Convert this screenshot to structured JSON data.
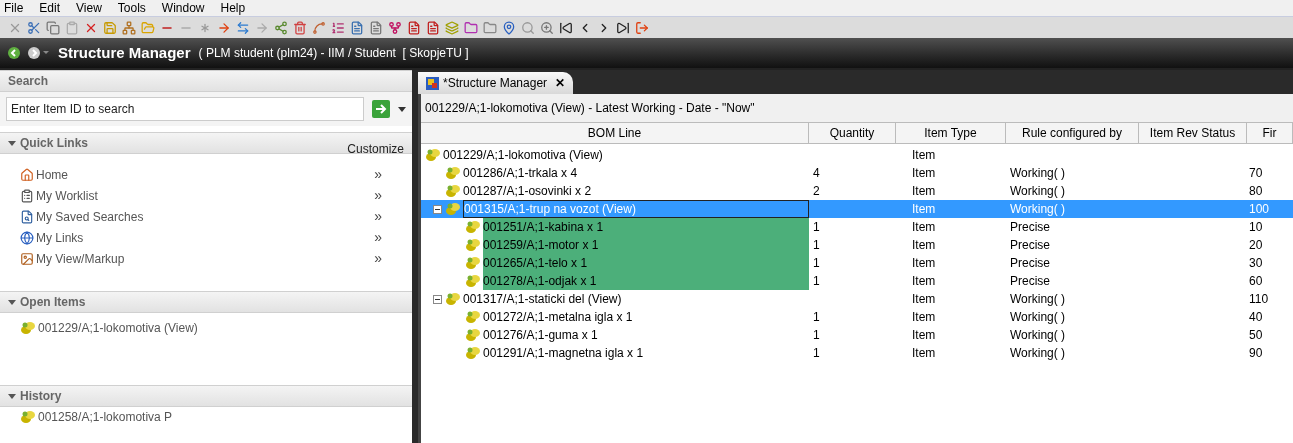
{
  "menu": [
    "File",
    "Edit",
    "View",
    "Tools",
    "Window",
    "Help"
  ],
  "header": {
    "title": "Structure Manager",
    "context": "( PLM student (plm24) - IIM / Student  [ SkopjeTU ]"
  },
  "sidebar": {
    "search": {
      "title": "Search",
      "placeholder": "Enter Item ID to search"
    },
    "quick_links": {
      "title": "Quick Links",
      "expanded": true,
      "action": "Customize",
      "items": [
        {
          "label": "Home",
          "kind": "home",
          "more": "»"
        },
        {
          "label": "My Worklist",
          "kind": "worklist",
          "more": "»"
        },
        {
          "label": "My Saved Searches",
          "kind": "searches",
          "more": "»"
        },
        {
          "label": "My Links",
          "kind": "links",
          "more": "»"
        },
        {
          "label": "My View/Markup",
          "kind": "markup",
          "more": "»"
        }
      ]
    },
    "open_items": {
      "title": "Open Items",
      "expanded": true,
      "items": [
        "001229/A;1-lokomotiva (View)"
      ]
    },
    "history": {
      "title": "History",
      "expanded": true,
      "items": [
        "001258/A;1-lokomotiva P"
      ]
    }
  },
  "editor": {
    "tab": {
      "label": "*Structure Manager",
      "close": "✕"
    },
    "path": "001229/A;1-lokomotiva (View) - Latest Working - Date - \"Now\"",
    "table": {
      "columns": [
        "BOM Line",
        "Quantity",
        "Item Type",
        "Rule configured by",
        "Item Rev Status",
        "Fir"
      ],
      "rows": [
        {
          "bom_line": "001229/A;1-lokomotiva (View)",
          "item_type": "Item",
          "selected": false,
          "highlighted": false,
          "children": [
            {
              "bom_line": "001286/A;1-trkala x 4",
              "quantity": "4",
              "item_type": "Item",
              "rule": "Working( )",
              "find_no": "70",
              "selected": false,
              "highlighted": false
            },
            {
              "bom_line": "001287/A;1-osovinki x 2",
              "quantity": "2",
              "item_type": "Item",
              "rule": "Working( )",
              "find_no": "80",
              "selected": false,
              "highlighted": false
            },
            {
              "bom_line": "001315/A;1-trup na vozot (View)",
              "item_type": "Item",
              "rule": "Working( )",
              "find_no": "100",
              "selected": true,
              "highlighted": false,
              "expanded": true,
              "children": [
                {
                  "bom_line": "001251/A;1-kabina x 1",
                  "quantity": "1",
                  "item_type": "Item",
                  "rule": "Precise",
                  "find_no": "10",
                  "selected": false,
                  "highlighted": true
                },
                {
                  "bom_line": "001259/A;1-motor x 1",
                  "quantity": "1",
                  "item_type": "Item",
                  "rule": "Precise",
                  "find_no": "20",
                  "selected": false,
                  "highlighted": true
                },
                {
                  "bom_line": "001265/A;1-telo x 1",
                  "quantity": "1",
                  "item_type": "Item",
                  "rule": "Precise",
                  "find_no": "30",
                  "selected": false,
                  "highlighted": true
                },
                {
                  "bom_line": "001278/A;1-odjak x 1",
                  "quantity": "1",
                  "item_type": "Item",
                  "rule": "Precise",
                  "find_no": "60",
                  "selected": false,
                  "highlighted": true
                }
              ]
            },
            {
              "bom_line": "001317/A;1-staticki del (View)",
              "item_type": "Item",
              "rule": "Working( )",
              "find_no": "110",
              "selected": false,
              "highlighted": false,
              "expanded": true,
              "children": [
                {
                  "bom_line": "001272/A;1-metalna igla x 1",
                  "quantity": "1",
                  "item_type": "Item",
                  "rule": "Working( )",
                  "find_no": "40",
                  "selected": false,
                  "highlighted": false
                },
                {
                  "bom_line": "001276/A;1-guma x 1",
                  "quantity": "1",
                  "item_type": "Item",
                  "rule": "Working( )",
                  "find_no": "50",
                  "selected": false,
                  "highlighted": false
                },
                {
                  "bom_line": "001291/A;1-magnetna igla x 1",
                  "quantity": "1",
                  "item_type": "Item",
                  "rule": "Working( )",
                  "find_no": "90",
                  "selected": false,
                  "highlighted": false
                }
              ]
            }
          ]
        }
      ]
    }
  }
}
